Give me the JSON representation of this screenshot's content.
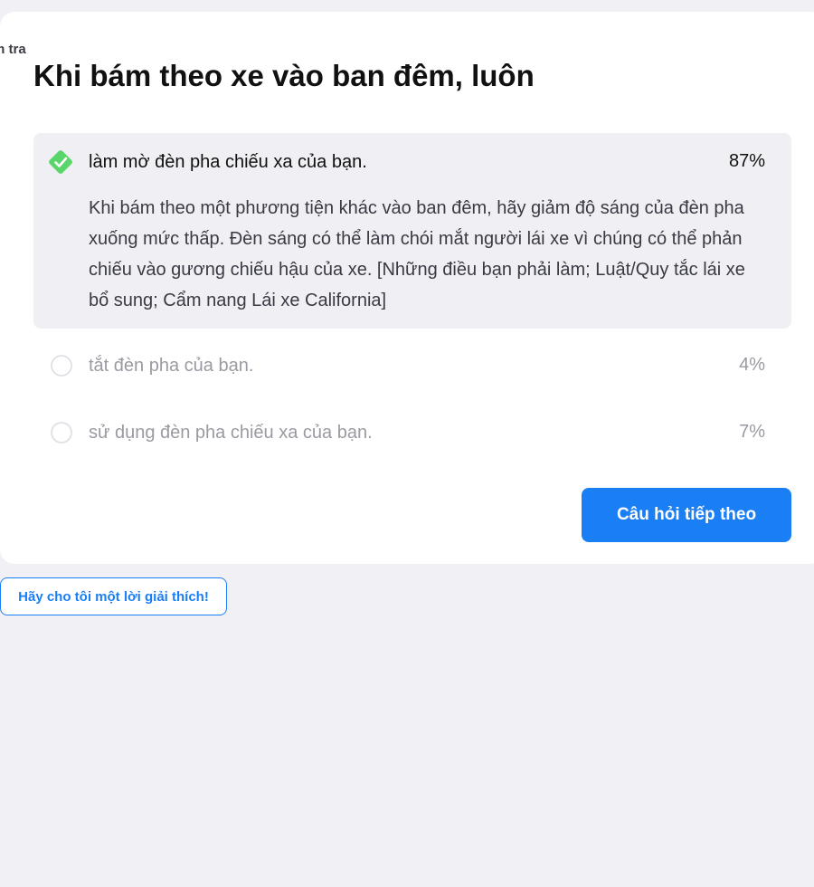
{
  "breadcrumb": "m tra",
  "question": "Khi bám theo xe vào ban đêm, luôn",
  "answers": [
    {
      "text": "làm mờ đèn pha chiếu xa của bạn.",
      "percent": "87%",
      "correct": true,
      "icon": "check-diamond-icon",
      "explanation": "Khi bám theo một phương tiện khác vào ban đêm, hãy giảm độ sáng của đèn pha xuống mức thấp. Đèn sáng có thể làm chói mắt người lái xe vì chúng có thể phản chiếu vào gương chiếu hậu của xe. [Những điều bạn phải làm; Luật/Quy tắc lái xe bổ sung; Cẩm nang Lái xe California]"
    },
    {
      "text": "tắt đèn pha của bạn.",
      "percent": "4%",
      "correct": false,
      "icon": "radio-empty-icon"
    },
    {
      "text": "sử dụng đèn pha chiếu xa của bạn.",
      "percent": "7%",
      "correct": false,
      "icon": "radio-empty-icon"
    }
  ],
  "buttons": {
    "next": "Câu hỏi tiếp theo",
    "explain": "Hãy cho tôi một lời giải thích!"
  },
  "colors": {
    "page_background": "#f0f0f5",
    "card_background": "#ffffff",
    "correct_highlight": "#efeff4",
    "correct_icon": "#5ad56a",
    "accent": "#1a7ff5",
    "muted_text": "#9a9aa2"
  }
}
